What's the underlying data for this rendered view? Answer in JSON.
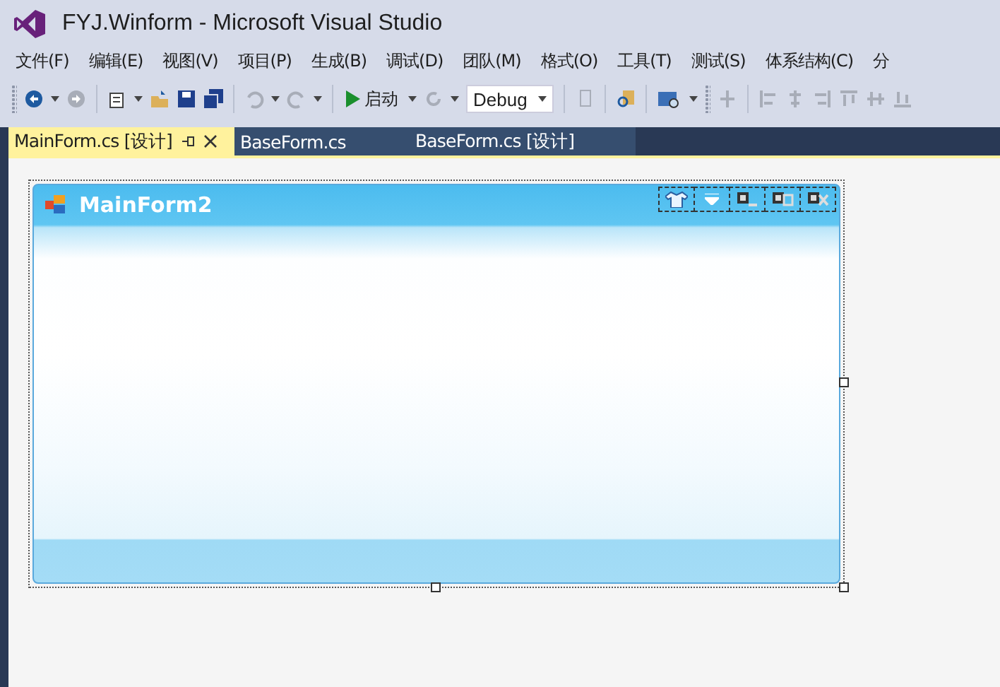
{
  "window": {
    "title": "FYJ.Winform - Microsoft Visual Studio"
  },
  "menu": [
    "文件(F)",
    "编辑(E)",
    "视图(V)",
    "项目(P)",
    "生成(B)",
    "调试(D)",
    "团队(M)",
    "格式(O)",
    "工具(T)",
    "测试(S)",
    "体系结构(C)",
    "分"
  ],
  "toolbar": {
    "start_label": "启动",
    "configuration": "Debug"
  },
  "tabs": [
    {
      "label": "MainForm.cs [设计]",
      "selected": true
    },
    {
      "label": "BaseForm.cs",
      "selected": false
    },
    {
      "label": "BaseForm.cs [设计]",
      "selected": false
    }
  ],
  "designer": {
    "form_title": "MainForm2"
  }
}
